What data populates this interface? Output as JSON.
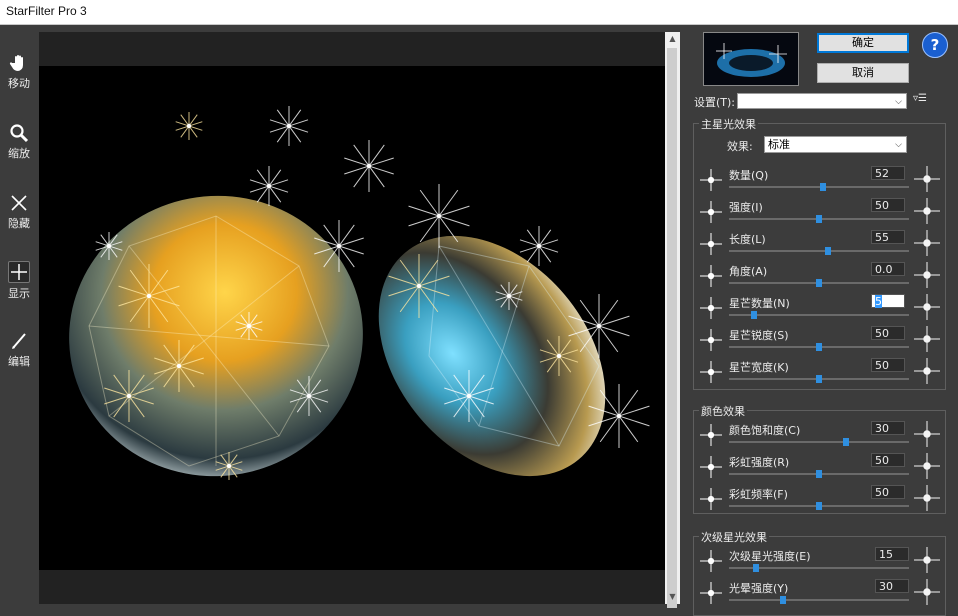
{
  "window": {
    "title": "StarFilter Pro 3"
  },
  "tools": [
    {
      "label": "移动",
      "icon": "hand-icon"
    },
    {
      "label": "缩放",
      "icon": "magnifier-icon"
    },
    {
      "label": "隐藏",
      "icon": "x-icon"
    },
    {
      "label": "显示",
      "icon": "plus-grid-icon"
    },
    {
      "label": "编辑",
      "icon": "pencil-icon"
    }
  ],
  "buttons": {
    "ok": "确定",
    "cancel": "取消",
    "help": "?"
  },
  "settings": {
    "label": "设置(T):",
    "value": ""
  },
  "main_star": {
    "title": "主星光效果",
    "effect_label": "效果:",
    "effect_value": "标准",
    "rows": [
      {
        "label": "数量(Q)",
        "value": "52",
        "slider": 0.52
      },
      {
        "label": "强度(I)",
        "value": "50",
        "slider": 0.5
      },
      {
        "label": "长度(L)",
        "value": "55",
        "slider": 0.55
      },
      {
        "label": "角度(A)",
        "value": "0.0",
        "slider": 0.5
      },
      {
        "label": "星芒数量(N)",
        "value": "5",
        "slider": 0.14
      },
      {
        "label": "星芒锐度(S)",
        "value": "50",
        "slider": 0.5
      },
      {
        "label": "星芒宽度(K)",
        "value": "50",
        "slider": 0.5
      }
    ]
  },
  "color_effect": {
    "title": "颜色效果",
    "rows": [
      {
        "label": "颜色饱和度(C)",
        "value": "30",
        "slider": 0.65
      },
      {
        "label": "彩虹强度(R)",
        "value": "50",
        "slider": 0.5
      },
      {
        "label": "彩虹频率(F)",
        "value": "50",
        "slider": 0.5
      }
    ]
  },
  "secondary_star": {
    "title": "次级星光效果",
    "rows": [
      {
        "label": "次级星光强度(E)",
        "value": "15",
        "slider": 0.15
      },
      {
        "label": "光晕强度(Y)",
        "value": "30",
        "slider": 0.3
      }
    ]
  },
  "colors": {
    "accent": "#2f8fe0",
    "panel_bg": "#3c3c3c",
    "help": "#1a5fd0"
  }
}
